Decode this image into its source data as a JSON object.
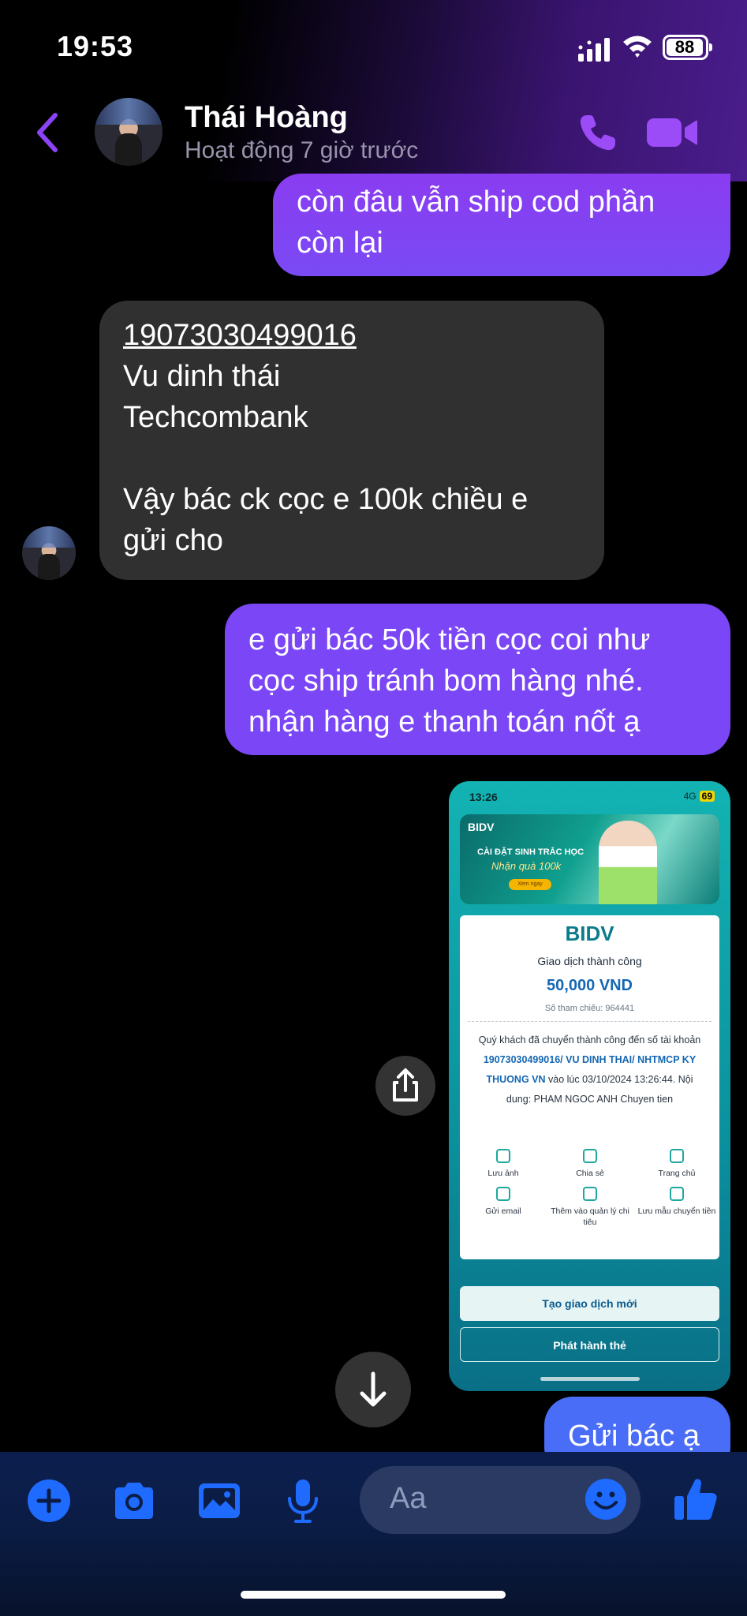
{
  "status": {
    "time": "19:53",
    "battery": "88"
  },
  "header": {
    "contact_name": "Thái Hoàng",
    "presence": "Hoạt động 7 giờ trước"
  },
  "messages": {
    "m1": {
      "line1": "còn đâu vẫn ship cod phần",
      "line2": "còn lại"
    },
    "m2": {
      "account": "19073030499016",
      "name": "Vu dinh thái",
      "bank": "Techcombank",
      "line4": "Vậy bác ck cọc e 100k chiều e",
      "line5": "gửi cho"
    },
    "m3": {
      "line1": "e gửi bác 50k tiền cọc coi như",
      "line2": "cọc ship tránh bom hàng nhé.",
      "line3": "nhận hàng e thanh toán nốt ạ"
    },
    "m5": "Gửi bác ạ"
  },
  "screenshot": {
    "time": "13:26",
    "network": "4G",
    "battery": "69",
    "banner_logo": "BIDV",
    "banner_title": "CÀI ĐẶT SINH TRẮC HỌC",
    "banner_sub": "Nhận quà 100k",
    "banner_btn": "Xem ngay",
    "logo": "BIDV",
    "result": "Giao dịch thành công",
    "amount": "50,000 VND",
    "ref": "Số tham chiếu: 964441",
    "detail_a": "Quý khách đã chuyển thành công đến số tài khoản",
    "detail_b": "19073030499016/ VU DINH THAI/ NHTMCP KY THUONG VN",
    "detail_c": "vào lúc 03/10/2024 13:26:44. Nội dung: PHAM NGOC ANH Chuyen tien",
    "actions": [
      "Lưu ảnh",
      "Chia sẻ",
      "Trang chủ",
      "Gửi email",
      "Thêm vào quản lý chi tiêu",
      "Lưu mẫu chuyển tiền"
    ],
    "btn_new": "Tạo giao dịch mới",
    "btn_card": "Phát hành thẻ"
  },
  "composer": {
    "placeholder": "Aa"
  },
  "colors": {
    "accent": "#7b46f6",
    "sent_blue": "#4a6df7",
    "received": "#303030",
    "messenger_blue": "#1f6bff"
  }
}
